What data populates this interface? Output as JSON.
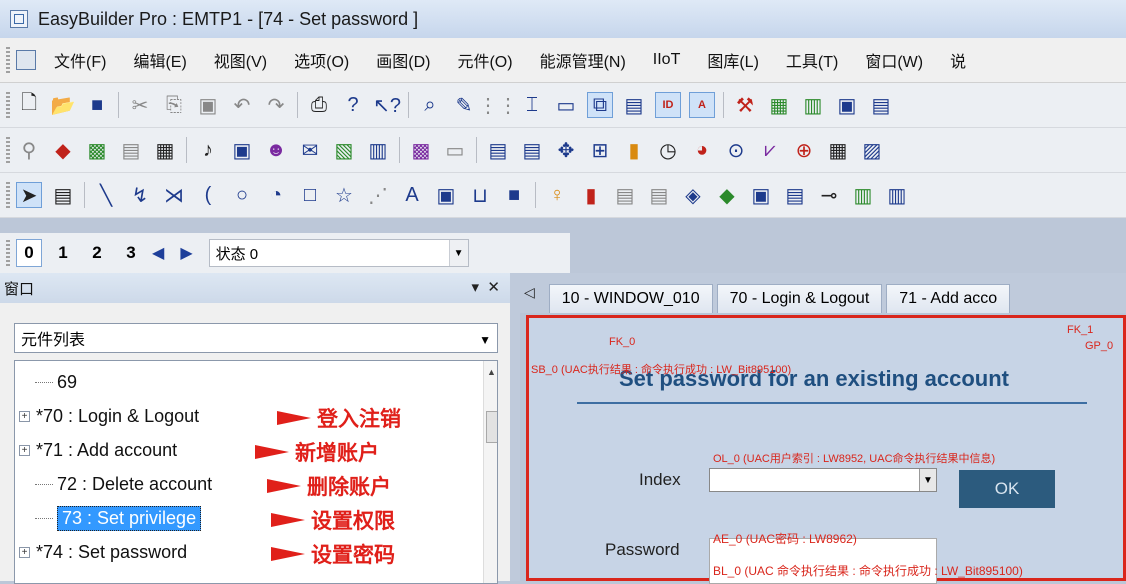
{
  "window": {
    "title": "EasyBuilder Pro : EMTP1 - [74 - Set password ]"
  },
  "menu": [
    "文件(F)",
    "编辑(E)",
    "视图(V)",
    "选项(O)",
    "画图(D)",
    "元件(O)",
    "能源管理(N)",
    "IIoT",
    "图库(L)",
    "工具(T)",
    "窗口(W)",
    "说"
  ],
  "toolbar_icons": [
    "new-icon",
    "open-icon",
    "save-icon",
    "cut-icon",
    "copy-icon",
    "paste-icon",
    "undo-icon",
    "redo-icon",
    "print-icon",
    "help-icon",
    "whats-this-icon",
    "find-icon",
    "pen-icon",
    "grid-icon",
    "align-icon",
    "frame-icon",
    "layer-icon",
    "doc-icon",
    "id-icon",
    "text-icon",
    "tools-icon",
    "chart-icon",
    "book-icon",
    "user-icon",
    "export-icon"
  ],
  "states": {
    "numbers": [
      "0",
      "1",
      "2",
      "3"
    ],
    "active": "0",
    "selected_label": "状态 0"
  },
  "panel": {
    "title": "窗口",
    "list_type": "元件列表",
    "tree": [
      {
        "text": "69",
        "type": "leaf"
      },
      {
        "text": "*70 : Login & Logout",
        "type": "expandable",
        "annotation": "登入注销"
      },
      {
        "text": "*71 : Add account",
        "type": "expandable",
        "annotation": "新增账户"
      },
      {
        "text": "72 : Delete account",
        "type": "leaf",
        "annotation": "删除账户"
      },
      {
        "text": "73 : Set privilege",
        "type": "leaf",
        "selected": true,
        "annotation": "设置权限"
      },
      {
        "text": "*74 : Set password",
        "type": "expandable",
        "annotation": "设置密码"
      }
    ]
  },
  "tabs": [
    "10 - WINDOW_010",
    "70 - Login & Logout",
    "71 - Add acco"
  ],
  "canvas": {
    "heading": "Set password for an existing account",
    "index_label": "Index",
    "password_label": "Password",
    "ok_label": "OK",
    "fk0": "FK_0",
    "fk1": "FK_1",
    "gp0": "GP_0",
    "sb0": "SB_0 (UAC执行结果 : 命令执行成功 : LW_Bit895100)",
    "ol0": "OL_0 (UAC用户索引 : LW8952, UAC命令执行结果中信息)",
    "ae0": "AE_0 (UAC密码 : LW8962)",
    "bl0": "BL_0 (UAC 命令执行结果 : 命令执行成功 : LW_Bit895100)"
  }
}
